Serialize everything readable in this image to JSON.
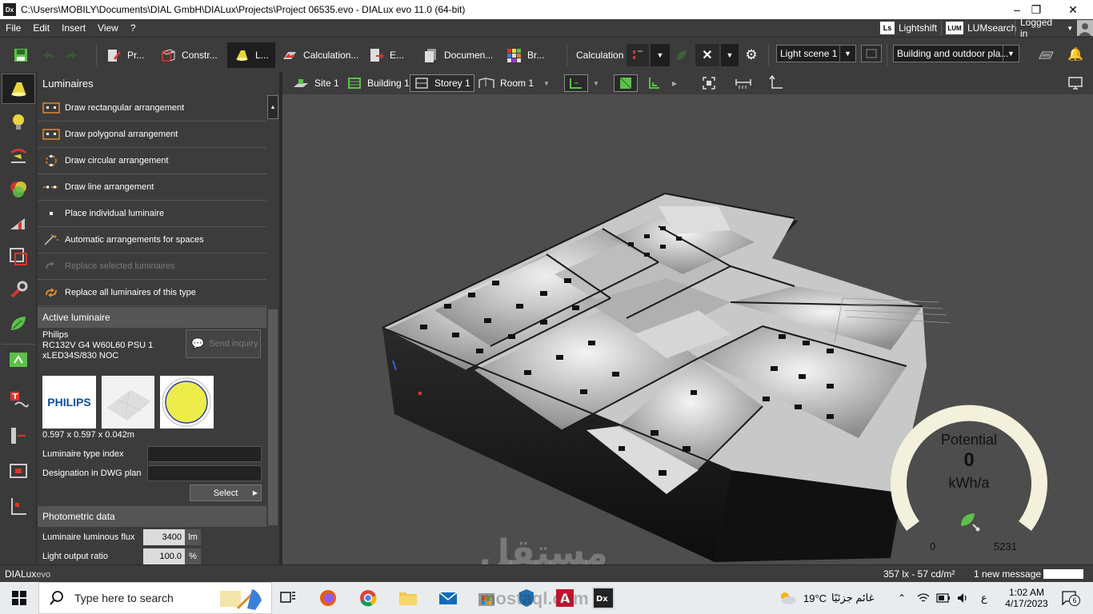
{
  "window": {
    "title": "C:\\Users\\MOBILY\\Documents\\DIAL GmbH\\DIALux\\Projects\\Project 06535.evo - DIALux evo 11.0  (64-bit)",
    "app_badge": "Dx",
    "controls": {
      "minimize": "–",
      "maximize": "❐",
      "close": "✕"
    }
  },
  "menu": {
    "items": [
      "File",
      "Edit",
      "Insert",
      "View",
      "?"
    ],
    "lightshift_badge": "Ls",
    "lightshift": "Lightshift",
    "lumsearch_badge": "LUM",
    "lumsearch": "LUMsearch",
    "logged_in": "Logged in"
  },
  "toolbar": {
    "tabs": [
      {
        "label": "Pr..."
      },
      {
        "label": "Constr..."
      },
      {
        "label": "L..."
      },
      {
        "label": "Calculation..."
      },
      {
        "label": "E..."
      },
      {
        "label": "Documen..."
      },
      {
        "label": "Br..."
      }
    ],
    "calculation_label": "Calculation",
    "light_scene": "Light scene 1",
    "view_mode": "Building and outdoor pla..."
  },
  "panel": {
    "title": "Luminaires",
    "items": [
      {
        "label": "Draw rectangular arrangement",
        "enabled": true
      },
      {
        "label": "Draw polygonal arrangement",
        "enabled": true
      },
      {
        "label": "Draw circular arrangement",
        "enabled": true
      },
      {
        "label": "Draw line arrangement",
        "enabled": true
      },
      {
        "label": "Place individual luminaire",
        "enabled": true
      },
      {
        "label": "Automatic arrangements for spaces",
        "enabled": true
      },
      {
        "label": "Replace selected luminaires",
        "enabled": false
      },
      {
        "label": "Replace all luminaires of this type",
        "enabled": true
      }
    ],
    "active_luminaire": {
      "header": "Active luminaire",
      "manufacturer": "Philips",
      "model_line1": "RC132V G4 W60L60 PSU 1",
      "model_line2": "xLED34S/830 NOC",
      "send_inquiry": "Send inquiry",
      "logo_text": "PHILIPS",
      "dimensions": "0.597 x 0.597 x 0.042m",
      "type_index_label": "Luminaire type index",
      "dwg_label": "Designation in DWG plan",
      "select_button": "Select"
    },
    "photometric": {
      "header": "Photometric data",
      "flux_label": "Luminaire luminous flux",
      "flux_value": "3400",
      "flux_unit": "lm",
      "lor_label": "Light output ratio",
      "lor_value": "100.0",
      "lor_unit": "%"
    }
  },
  "viewport_toolbar": {
    "crumbs": [
      "Site 1",
      "Building 1",
      "Storey 1",
      "Room 1"
    ],
    "active_crumb": "Storey 1"
  },
  "gauge": {
    "title": "Potential",
    "value": "0",
    "unit": "kWh/a",
    "min_label": "0",
    "max_label": "5231",
    "level": 0
  },
  "status": {
    "logo_a": "DIALux",
    "logo_b": "evo",
    "readout": "357 lx - 57 cd/m²",
    "messages": "1 new message"
  },
  "taskbar": {
    "search_placeholder": "Type here to search",
    "weather_temp": "19°C",
    "weather_desc": "غائم جزئيًا",
    "lang": "ع",
    "time": "1:02 AM",
    "date": "4/17/2023",
    "notifications": "6"
  },
  "watermark": {
    "arabic": "مستقل",
    "latin": "mostaql.com"
  },
  "colors": {
    "accent_green": "#5cc14a",
    "panel_bg": "#3c3c3c",
    "gauge_ring": "#f3f0dc"
  }
}
